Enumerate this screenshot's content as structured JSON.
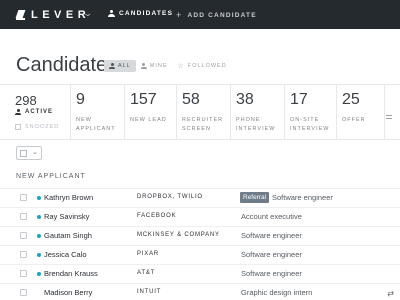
{
  "nav": {
    "brand": "LEVER",
    "candidates_label": "CANDIDATES",
    "add_candidate_label": "ADD CANDIDATE"
  },
  "page": {
    "title": "Candidates",
    "filters": [
      {
        "label": "ALL",
        "icon": "people-icon",
        "active": true
      },
      {
        "label": "MINE",
        "icon": "person-icon",
        "active": false
      },
      {
        "label": "FOLLOWED",
        "icon": "star-icon",
        "active": false
      }
    ]
  },
  "stats": {
    "active_count": "298",
    "active_label": "ACTIVE",
    "snoozed_label": "SNOOZED",
    "stages": [
      {
        "count": "9",
        "label": "NEW APPLICANT"
      },
      {
        "count": "157",
        "label": "NEW LEAD"
      },
      {
        "count": "58",
        "label": "RECRUITER SCREEN"
      },
      {
        "count": "38",
        "label": "PHONE INTERVIEW"
      },
      {
        "count": "17",
        "label": "ON-SITE INTERVIEW"
      },
      {
        "count": "25",
        "label": "OFFER"
      }
    ]
  },
  "section": {
    "title": "NEW APPLICANT"
  },
  "candidates": [
    {
      "name": "Kathryn Brown",
      "company": "DROPBOX, TWILIO",
      "tag": "Referral",
      "role": "Software engineer",
      "unread": true
    },
    {
      "name": "Ray Savinsky",
      "company": "FACEBOOK",
      "tag": "",
      "role": "Account executive",
      "unread": true
    },
    {
      "name": "Gautam Singh",
      "company": "MCKINSEY & COMPANY",
      "tag": "",
      "role": "Software engineer",
      "unread": true
    },
    {
      "name": "Jessica Calo",
      "company": "PIXAR",
      "tag": "",
      "role": "Software engineer",
      "unread": true
    },
    {
      "name": "Brendan Krauss",
      "company": "AT&T",
      "tag": "",
      "role": "Software engineer",
      "unread": true
    },
    {
      "name": "Madison Berry",
      "company": "INTUIT",
      "tag": "",
      "role": "Graphic design intern",
      "unread": false
    }
  ],
  "colors": {
    "nav_bg": "#252a2f",
    "unread_dot": "#1aa3c9",
    "tag_bg": "#6f7d8a"
  }
}
